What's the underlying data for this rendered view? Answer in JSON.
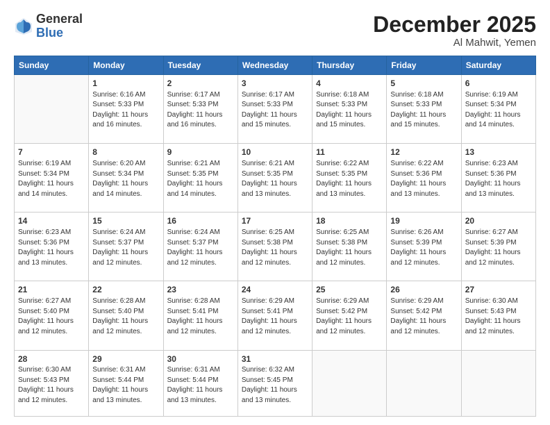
{
  "logo": {
    "general": "General",
    "blue": "Blue"
  },
  "header": {
    "month": "December 2025",
    "location": "Al Mahwit, Yemen"
  },
  "weekdays": [
    "Sunday",
    "Monday",
    "Tuesday",
    "Wednesday",
    "Thursday",
    "Friday",
    "Saturday"
  ],
  "weeks": [
    [
      {
        "day": "",
        "info": ""
      },
      {
        "day": "1",
        "info": "Sunrise: 6:16 AM\nSunset: 5:33 PM\nDaylight: 11 hours\nand 16 minutes."
      },
      {
        "day": "2",
        "info": "Sunrise: 6:17 AM\nSunset: 5:33 PM\nDaylight: 11 hours\nand 16 minutes."
      },
      {
        "day": "3",
        "info": "Sunrise: 6:17 AM\nSunset: 5:33 PM\nDaylight: 11 hours\nand 15 minutes."
      },
      {
        "day": "4",
        "info": "Sunrise: 6:18 AM\nSunset: 5:33 PM\nDaylight: 11 hours\nand 15 minutes."
      },
      {
        "day": "5",
        "info": "Sunrise: 6:18 AM\nSunset: 5:33 PM\nDaylight: 11 hours\nand 15 minutes."
      },
      {
        "day": "6",
        "info": "Sunrise: 6:19 AM\nSunset: 5:34 PM\nDaylight: 11 hours\nand 14 minutes."
      }
    ],
    [
      {
        "day": "7",
        "info": "Sunrise: 6:19 AM\nSunset: 5:34 PM\nDaylight: 11 hours\nand 14 minutes."
      },
      {
        "day": "8",
        "info": "Sunrise: 6:20 AM\nSunset: 5:34 PM\nDaylight: 11 hours\nand 14 minutes."
      },
      {
        "day": "9",
        "info": "Sunrise: 6:21 AM\nSunset: 5:35 PM\nDaylight: 11 hours\nand 14 minutes."
      },
      {
        "day": "10",
        "info": "Sunrise: 6:21 AM\nSunset: 5:35 PM\nDaylight: 11 hours\nand 13 minutes."
      },
      {
        "day": "11",
        "info": "Sunrise: 6:22 AM\nSunset: 5:35 PM\nDaylight: 11 hours\nand 13 minutes."
      },
      {
        "day": "12",
        "info": "Sunrise: 6:22 AM\nSunset: 5:36 PM\nDaylight: 11 hours\nand 13 minutes."
      },
      {
        "day": "13",
        "info": "Sunrise: 6:23 AM\nSunset: 5:36 PM\nDaylight: 11 hours\nand 13 minutes."
      }
    ],
    [
      {
        "day": "14",
        "info": "Sunrise: 6:23 AM\nSunset: 5:36 PM\nDaylight: 11 hours\nand 13 minutes."
      },
      {
        "day": "15",
        "info": "Sunrise: 6:24 AM\nSunset: 5:37 PM\nDaylight: 11 hours\nand 12 minutes."
      },
      {
        "day": "16",
        "info": "Sunrise: 6:24 AM\nSunset: 5:37 PM\nDaylight: 11 hours\nand 12 minutes."
      },
      {
        "day": "17",
        "info": "Sunrise: 6:25 AM\nSunset: 5:38 PM\nDaylight: 11 hours\nand 12 minutes."
      },
      {
        "day": "18",
        "info": "Sunrise: 6:25 AM\nSunset: 5:38 PM\nDaylight: 11 hours\nand 12 minutes."
      },
      {
        "day": "19",
        "info": "Sunrise: 6:26 AM\nSunset: 5:39 PM\nDaylight: 11 hours\nand 12 minutes."
      },
      {
        "day": "20",
        "info": "Sunrise: 6:27 AM\nSunset: 5:39 PM\nDaylight: 11 hours\nand 12 minutes."
      }
    ],
    [
      {
        "day": "21",
        "info": "Sunrise: 6:27 AM\nSunset: 5:40 PM\nDaylight: 11 hours\nand 12 minutes."
      },
      {
        "day": "22",
        "info": "Sunrise: 6:28 AM\nSunset: 5:40 PM\nDaylight: 11 hours\nand 12 minutes."
      },
      {
        "day": "23",
        "info": "Sunrise: 6:28 AM\nSunset: 5:41 PM\nDaylight: 11 hours\nand 12 minutes."
      },
      {
        "day": "24",
        "info": "Sunrise: 6:29 AM\nSunset: 5:41 PM\nDaylight: 11 hours\nand 12 minutes."
      },
      {
        "day": "25",
        "info": "Sunrise: 6:29 AM\nSunset: 5:42 PM\nDaylight: 11 hours\nand 12 minutes."
      },
      {
        "day": "26",
        "info": "Sunrise: 6:29 AM\nSunset: 5:42 PM\nDaylight: 11 hours\nand 12 minutes."
      },
      {
        "day": "27",
        "info": "Sunrise: 6:30 AM\nSunset: 5:43 PM\nDaylight: 11 hours\nand 12 minutes."
      }
    ],
    [
      {
        "day": "28",
        "info": "Sunrise: 6:30 AM\nSunset: 5:43 PM\nDaylight: 11 hours\nand 12 minutes."
      },
      {
        "day": "29",
        "info": "Sunrise: 6:31 AM\nSunset: 5:44 PM\nDaylight: 11 hours\nand 13 minutes."
      },
      {
        "day": "30",
        "info": "Sunrise: 6:31 AM\nSunset: 5:44 PM\nDaylight: 11 hours\nand 13 minutes."
      },
      {
        "day": "31",
        "info": "Sunrise: 6:32 AM\nSunset: 5:45 PM\nDaylight: 11 hours\nand 13 minutes."
      },
      {
        "day": "",
        "info": ""
      },
      {
        "day": "",
        "info": ""
      },
      {
        "day": "",
        "info": ""
      }
    ]
  ]
}
